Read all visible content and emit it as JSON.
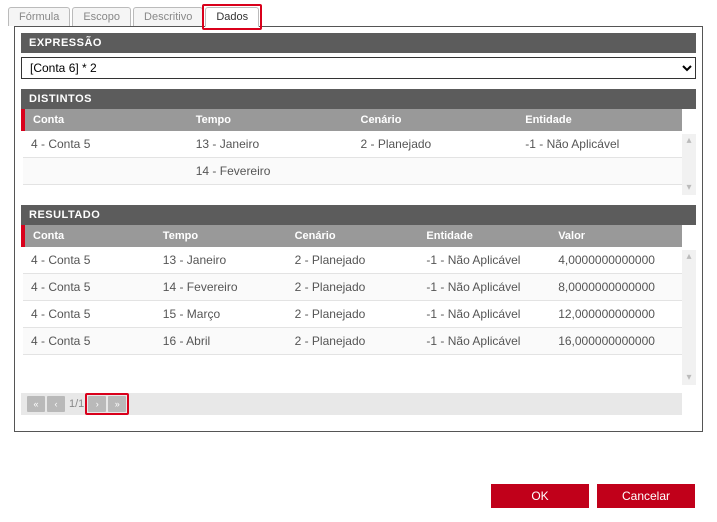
{
  "tabs": {
    "formula": "Fórmula",
    "escopo": "Escopo",
    "descritivo": "Descritivo",
    "dados": "Dados"
  },
  "sections": {
    "expressao": "EXPRESSÃO",
    "distintos": "DISTINTOS",
    "resultado": "RESULTADO"
  },
  "expr": {
    "selected": "[Conta 6] * 2"
  },
  "distintos": {
    "headers": {
      "conta": "Conta",
      "tempo": "Tempo",
      "cenario": "Cenário",
      "entidade": "Entidade"
    },
    "rows": [
      {
        "conta": "4 - Conta 5",
        "tempo": "13 - Janeiro",
        "cenario": "2 - Planejado",
        "entidade": "-1 - Não Aplicável"
      },
      {
        "conta": "",
        "tempo": "14 - Fevereiro",
        "cenario": "",
        "entidade": ""
      }
    ]
  },
  "resultado": {
    "headers": {
      "conta": "Conta",
      "tempo": "Tempo",
      "cenario": "Cenário",
      "entidade": "Entidade",
      "valor": "Valor"
    },
    "rows": [
      {
        "conta": "4 - Conta 5",
        "tempo": "13 - Janeiro",
        "cenario": "2 - Planejado",
        "entidade": "-1 - Não Aplicável",
        "valor": "4,0000000000000"
      },
      {
        "conta": "4 - Conta 5",
        "tempo": "14 - Fevereiro",
        "cenario": "2 - Planejado",
        "entidade": "-1 - Não Aplicável",
        "valor": "8,0000000000000"
      },
      {
        "conta": "4 - Conta 5",
        "tempo": "15 - Março",
        "cenario": "2 - Planejado",
        "entidade": "-1 - Não Aplicável",
        "valor": "12,000000000000"
      },
      {
        "conta": "4 - Conta 5",
        "tempo": "16 - Abril",
        "cenario": "2 - Planejado",
        "entidade": "-1 - Não Aplicável",
        "valor": "16,000000000000"
      }
    ]
  },
  "pager": {
    "info": "1/1"
  },
  "footer": {
    "ok": "OK",
    "cancel": "Cancelar"
  }
}
